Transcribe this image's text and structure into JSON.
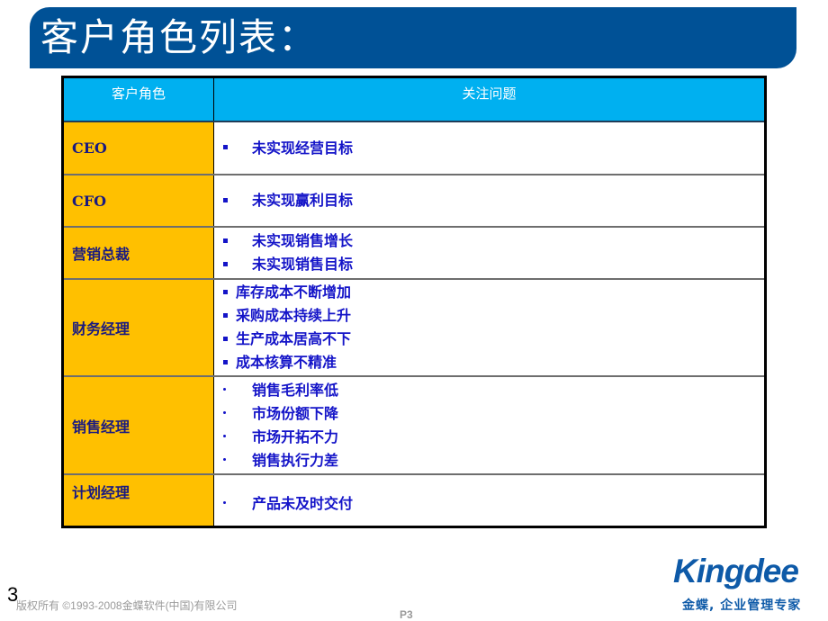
{
  "title": "客户角色列表：",
  "table": {
    "headers": [
      "客户角色",
      "关注问题"
    ],
    "rows": [
      {
        "role": "CEO",
        "bullet": "square",
        "issues": [
          "未实现经营目标"
        ]
      },
      {
        "role": "CFO",
        "bullet": "square",
        "issues": [
          "未实现赢利目标"
        ]
      },
      {
        "role": "营销总裁",
        "bullet": "square",
        "issues": [
          "未实现销售增长",
          "未实现销售目标"
        ]
      },
      {
        "role": "财务经理",
        "bullet": "square",
        "issues": [
          "库存成本不断增加",
          "采购成本持续上升",
          "生产成本居高不下",
          "成本核算不精准"
        ]
      },
      {
        "role": "销售经理",
        "bullet": "dot",
        "issues": [
          "销售毛利率低",
          "市场份额下降",
          "市场开拓不力",
          "销售执行力差"
        ]
      },
      {
        "role": "计划经理",
        "bullet": "dot",
        "issues": [
          "产品未及时交付"
        ]
      }
    ]
  },
  "footer": {
    "slide_number": "3",
    "copyright": "版权所有 ©1993-2008金蝶软件(中国)有限公司",
    "page_label": "P3",
    "logo": "Kingdee",
    "slogan": "金蝶, 企业管理专家"
  },
  "colors": {
    "title_bar": "#005196",
    "header_bg": "#00b0f0",
    "role_bg": "#ffc000",
    "issue_text": "#1414c8",
    "logo": "#0e5aa8"
  }
}
